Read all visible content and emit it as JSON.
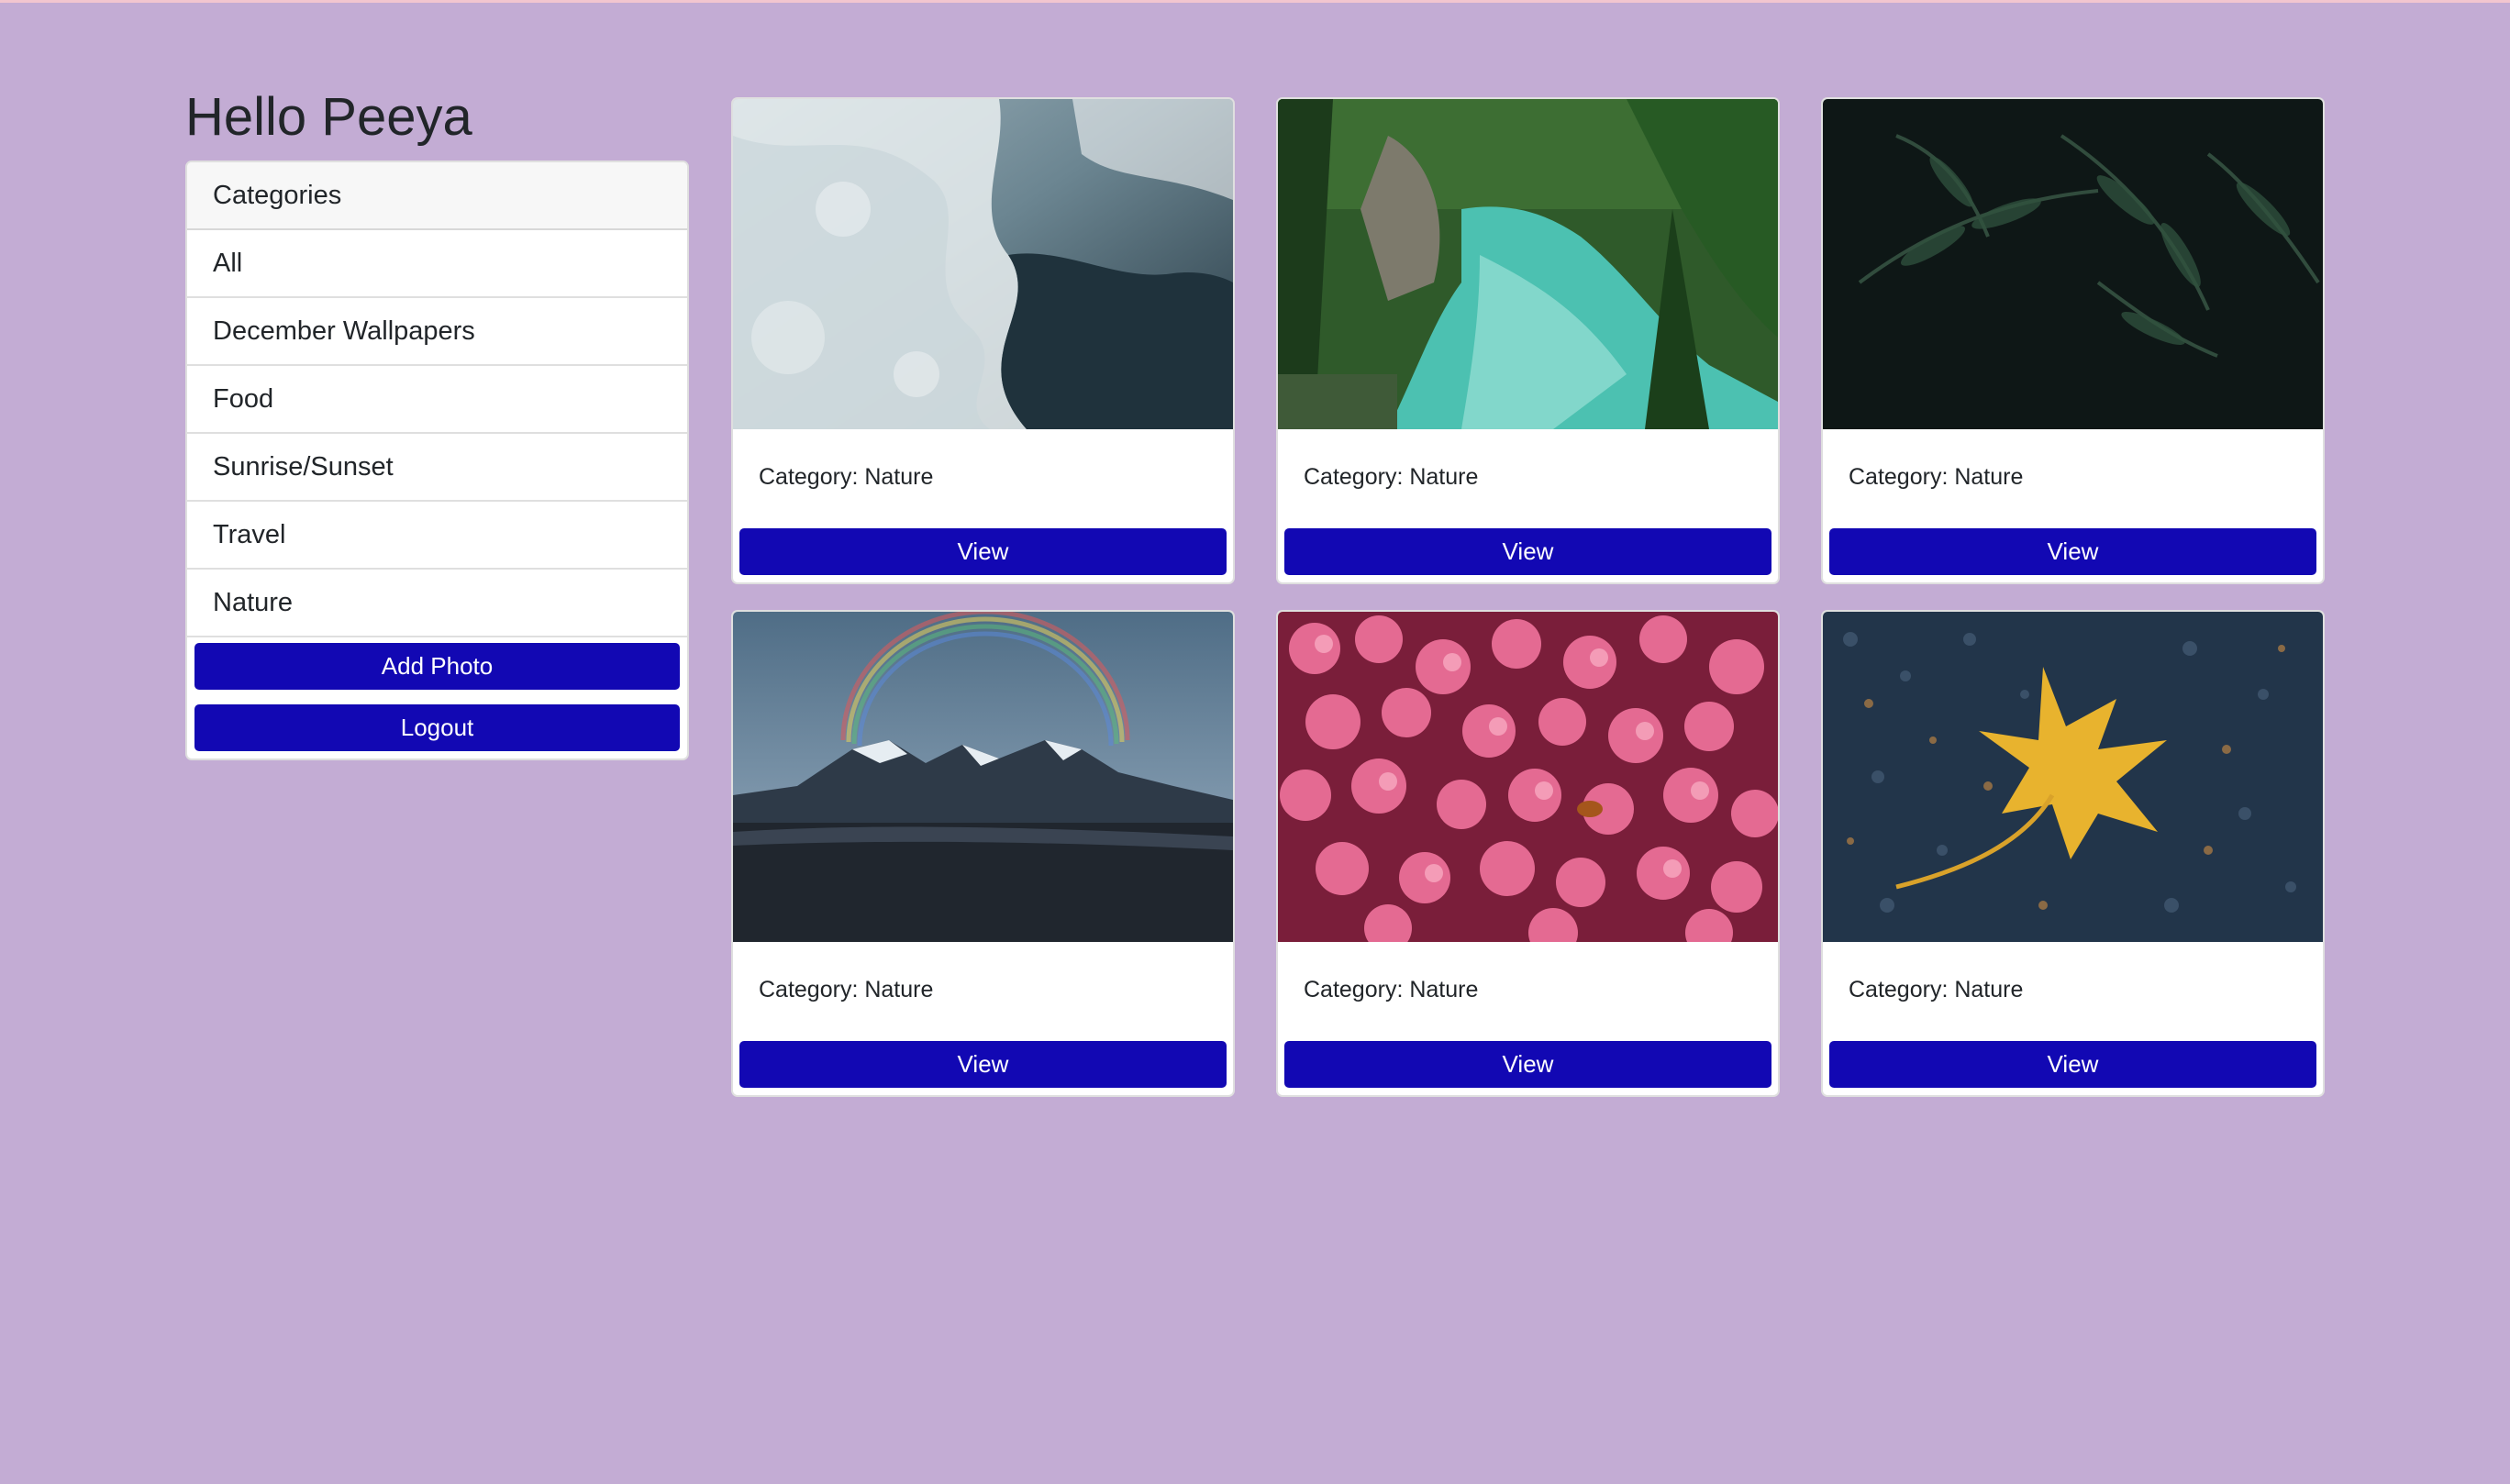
{
  "colors": {
    "page_background": "#c3acd4",
    "top_rule": "#f2c6cf",
    "primary_button": "#1208b3",
    "card_background": "#ffffff"
  },
  "greeting": "Hello Peeya",
  "sidebar": {
    "header": "Categories",
    "categories": [
      "All",
      "December Wallpapers",
      "Food",
      "Sunrise/Sunset",
      "Travel",
      "Nature"
    ],
    "add_photo_label": "Add Photo",
    "logout_label": "Logout"
  },
  "photos": [
    {
      "category_text": "Category: Nature",
      "view_label": "View",
      "subject": "ocean waves aerial"
    },
    {
      "category_text": "Category: Nature",
      "view_label": "View",
      "subject": "turquoise river forest"
    },
    {
      "category_text": "Category: Nature",
      "view_label": "View",
      "subject": "dark fern leaves"
    },
    {
      "category_text": "Category: Nature",
      "view_label": "View",
      "subject": "mountain rainbow"
    },
    {
      "category_text": "Category: Nature",
      "view_label": "View",
      "subject": "pink flowers"
    },
    {
      "category_text": "Category: Nature",
      "view_label": "View",
      "subject": "yellow leaf on asphalt"
    }
  ]
}
